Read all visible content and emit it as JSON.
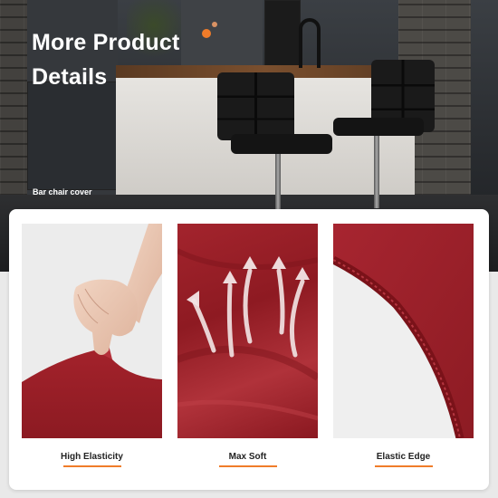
{
  "hero": {
    "title_line1": "More Product",
    "title_line2": "Details",
    "subtitle": "Bar chair cover"
  },
  "features": [
    {
      "label": "High Elasticity"
    },
    {
      "label": "Max Soft"
    },
    {
      "label": "Elastic Edge"
    }
  ],
  "colors": {
    "accent": "#f07c2a",
    "fabric_red": "#9b1e27",
    "text_dark": "#222222"
  }
}
